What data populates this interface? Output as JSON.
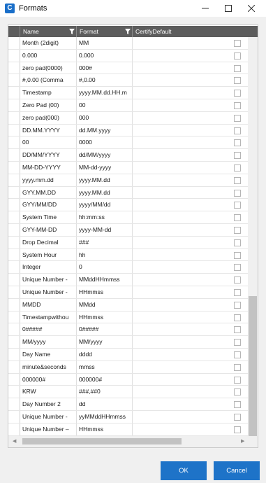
{
  "window": {
    "title": "Formats",
    "icon_letter": "C"
  },
  "grid": {
    "columns": [
      "Name",
      "Format",
      "CertifyDefault"
    ],
    "rows": [
      {
        "name": "Month (2digit)",
        "format": "MM"
      },
      {
        "name": "0.000",
        "format": "0.000"
      },
      {
        "name": "zero pad(0000)",
        "format": "000#"
      },
      {
        "name": "#,0.00 (Comma",
        "format": "#,0.00"
      },
      {
        "name": "Timestamp",
        "format": "yyyy.MM.dd.HH.m"
      },
      {
        "name": "Zero Pad (00)",
        "format": "00"
      },
      {
        "name": "zero pad(000)",
        "format": "000"
      },
      {
        "name": "DD.MM.YYYY",
        "format": "dd.MM.yyyy"
      },
      {
        "name": "00",
        "format": "0000"
      },
      {
        "name": "DD/MM/YYYY",
        "format": "dd/MM/yyyy"
      },
      {
        "name": "MM-DD-YYYY",
        "format": "MM-dd-yyyy"
      },
      {
        "name": "yyyy.mm.dd",
        "format": "yyyy.MM.dd"
      },
      {
        "name": "GYY.MM.DD",
        "format": "yyyy.MM.dd"
      },
      {
        "name": "GYY/MM/DD",
        "format": "yyyy/MM/dd"
      },
      {
        "name": "System Time",
        "format": "hh:mm:ss"
      },
      {
        "name": "GYY-MM-DD",
        "format": "yyyy-MM-dd"
      },
      {
        "name": "Drop Decimal",
        "format": "###"
      },
      {
        "name": "System Hour",
        "format": "hh"
      },
      {
        "name": "Integer",
        "format": "0"
      },
      {
        "name": "Unique Number -",
        "format": "MMddHHmmss"
      },
      {
        "name": "Unique Number -",
        "format": "HHmmss"
      },
      {
        "name": "MMDD",
        "format": "MMdd"
      },
      {
        "name": "Timestampwithou",
        "format": "HHmmss"
      },
      {
        "name": "0#####",
        "format": "0#####"
      },
      {
        "name": "MM/yyyy",
        "format": "MM/yyyy"
      },
      {
        "name": "Day Name",
        "format": "dddd"
      },
      {
        "name": "minute&seconds",
        "format": "mmss"
      },
      {
        "name": "000000#",
        "format": "000000#"
      },
      {
        "name": "KRW",
        "format": "###,##0"
      },
      {
        "name": "Day Number 2",
        "format": "dd"
      },
      {
        "name": "Unique Number -",
        "format": "yyMMddHHmmss"
      },
      {
        "name": "Unique Number –",
        "format": "HHmmss"
      }
    ]
  },
  "buttons": {
    "ok": "OK",
    "cancel": "Cancel"
  },
  "colors": {
    "accent": "#1e73c8",
    "header_bg": "#5d5d5d"
  }
}
